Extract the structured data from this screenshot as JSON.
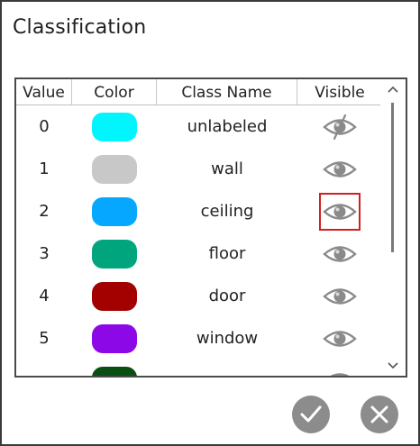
{
  "dialog": {
    "title": "Classification"
  },
  "table": {
    "columns": [
      "Value",
      "Color",
      "Class Name",
      "Visible"
    ],
    "rows": [
      {
        "value": "0",
        "color": "#00f5ff",
        "name": "unlabeled",
        "visible": false,
        "selected": false
      },
      {
        "value": "1",
        "color": "#c8c8c8",
        "name": "wall",
        "visible": true,
        "selected": false
      },
      {
        "value": "2",
        "color": "#06a8ff",
        "name": "ceiling",
        "visible": true,
        "selected": true
      },
      {
        "value": "3",
        "color": "#00a57e",
        "name": "floor",
        "visible": true,
        "selected": false
      },
      {
        "value": "4",
        "color": "#a30000",
        "name": "door",
        "visible": true,
        "selected": false
      },
      {
        "value": "5",
        "color": "#8c08e6",
        "name": "window",
        "visible": true,
        "selected": false
      },
      {
        "value": "",
        "color": "#0a4f12",
        "name": "",
        "visible": true,
        "selected": false
      }
    ],
    "visible_icon": "eye-icon",
    "hidden_icon": "eye-off-icon"
  },
  "actions": {
    "ok_icon": "checkmark-icon",
    "cancel_icon": "close-icon"
  }
}
